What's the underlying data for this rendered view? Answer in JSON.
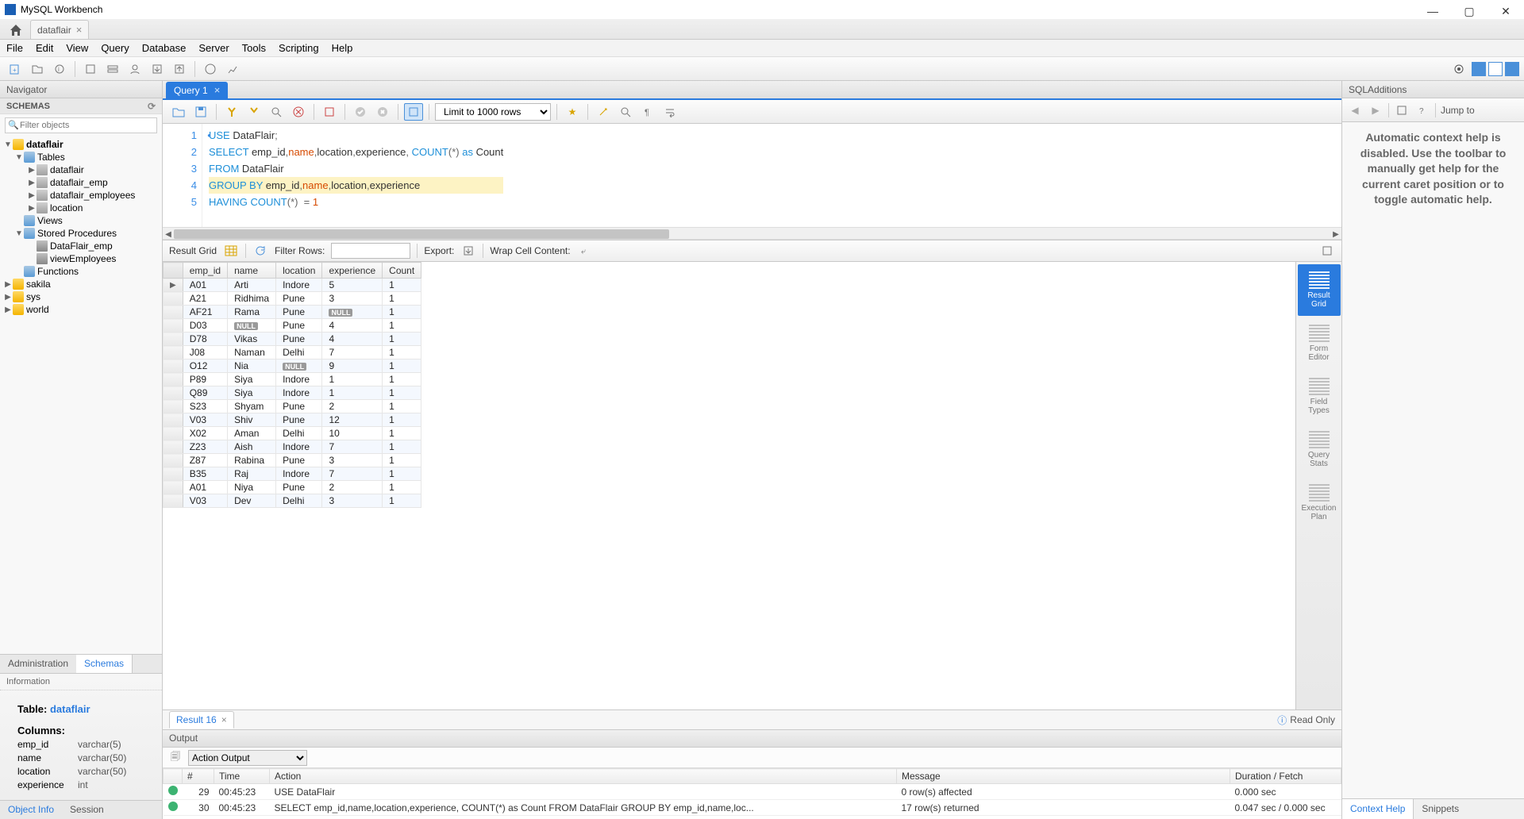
{
  "app_title": "MySQL Workbench",
  "connection_tab": "dataflair",
  "menu": [
    "File",
    "Edit",
    "View",
    "Query",
    "Database",
    "Server",
    "Tools",
    "Scripting",
    "Help"
  ],
  "navigator": {
    "title": "Navigator",
    "schemas_label": "SCHEMAS",
    "filter_placeholder": "Filter objects",
    "tree": {
      "db": "dataflair",
      "tables_label": "Tables",
      "tables": [
        "dataflair",
        "dataflair_emp",
        "dataflair_employees",
        "location"
      ],
      "views_label": "Views",
      "sp_label": "Stored Procedures",
      "sps": [
        "DataFlair_emp",
        "viewEmployees"
      ],
      "functions_label": "Functions",
      "other_dbs": [
        "sakila",
        "sys",
        "world"
      ]
    },
    "bottom_tabs": {
      "admin": "Administration",
      "schemas": "Schemas"
    },
    "info_title": "Information",
    "table_label": "Table:",
    "table_name": "dataflair",
    "columns_label": "Columns:",
    "columns": [
      {
        "name": "emp_id",
        "type": "varchar(5)"
      },
      {
        "name": "name",
        "type": "varchar(50)"
      },
      {
        "name": "location",
        "type": "varchar(50)"
      },
      {
        "name": "experience",
        "type": "int"
      }
    ],
    "foot_tabs": {
      "obj": "Object Info",
      "sess": "Session"
    }
  },
  "query_tab": "Query 1",
  "sql_toolbar": {
    "limit": "Limit to 1000 rows"
  },
  "sql_lines": [
    {
      "n": "1",
      "dot": true,
      "tokens": [
        [
          "kw",
          "USE"
        ],
        [
          "txt",
          " DataFlair"
        ],
        [
          "op",
          ";"
        ]
      ]
    },
    {
      "n": "2",
      "dot": false,
      "tokens": [
        [
          "kw",
          "SELECT"
        ],
        [
          "txt",
          " emp_id"
        ],
        [
          "op",
          ","
        ],
        [
          "ident",
          "name"
        ],
        [
          "op",
          ","
        ],
        [
          "txt",
          "location"
        ],
        [
          "op",
          ","
        ],
        [
          "txt",
          "experience"
        ],
        [
          "op",
          ", "
        ],
        [
          "fn",
          "COUNT"
        ],
        [
          "op",
          "(*) "
        ],
        [
          "kw",
          "as"
        ],
        [
          "txt",
          " Count"
        ]
      ]
    },
    {
      "n": "3",
      "dot": false,
      "tokens": [
        [
          "kw",
          "FROM"
        ],
        [
          "txt",
          " DataFlair"
        ]
      ]
    },
    {
      "n": "4",
      "dot": false,
      "hl": true,
      "tokens": [
        [
          "kw",
          "GROUP BY"
        ],
        [
          "txt",
          " emp_id"
        ],
        [
          "op",
          ","
        ],
        [
          "ident",
          "name"
        ],
        [
          "op",
          ","
        ],
        [
          "txt",
          "location"
        ],
        [
          "op",
          ","
        ],
        [
          "txt",
          "experience"
        ]
      ]
    },
    {
      "n": "5",
      "dot": false,
      "tokens": [
        [
          "kw",
          "HAVING"
        ],
        [
          "txt",
          " "
        ],
        [
          "fn",
          "COUNT"
        ],
        [
          "op",
          "(*)  = "
        ],
        [
          "num",
          "1"
        ]
      ]
    }
  ],
  "result_bar": {
    "label": "Result Grid",
    "filter_label": "Filter Rows:",
    "export_label": "Export:",
    "wrap_label": "Wrap Cell Content:"
  },
  "grid": {
    "headers": [
      "emp_id",
      "name",
      "location",
      "experience",
      "Count"
    ],
    "rows": [
      [
        "A01",
        "Arti",
        "Indore",
        "5",
        "1"
      ],
      [
        "A21",
        "Ridhima",
        "Pune",
        "3",
        "1"
      ],
      [
        "AF21",
        "Rama",
        "Pune",
        "__NULL__",
        "1"
      ],
      [
        "D03",
        "__NULL__",
        "Pune",
        "4",
        "1"
      ],
      [
        "D78",
        "Vikas",
        "Pune",
        "4",
        "1"
      ],
      [
        "J08",
        "Naman",
        "Delhi",
        "7",
        "1"
      ],
      [
        "O12",
        "Nia",
        "__NULL__",
        "9",
        "1"
      ],
      [
        "P89",
        "Siya",
        "Indore",
        "1",
        "1"
      ],
      [
        "Q89",
        "Siya",
        "Indore",
        "1",
        "1"
      ],
      [
        "S23",
        "Shyam",
        "Pune",
        "2",
        "1"
      ],
      [
        "V03",
        "Shiv",
        "Pune",
        "12",
        "1"
      ],
      [
        "X02",
        "Aman",
        "Delhi",
        "10",
        "1"
      ],
      [
        "Z23",
        "Aish",
        "Indore",
        "7",
        "1"
      ],
      [
        "Z87",
        "Rabina",
        "Pune",
        "3",
        "1"
      ],
      [
        "B35",
        "Raj",
        "Indore",
        "7",
        "1"
      ],
      [
        "A01",
        "Niya",
        "Pune",
        "2",
        "1"
      ],
      [
        "V03",
        "Dev",
        "Delhi",
        "3",
        "1"
      ]
    ]
  },
  "rail": [
    "Result Grid",
    "Form Editor",
    "Field Types",
    "Query Stats",
    "Execution Plan"
  ],
  "result_tab": "Result 16",
  "readonly_label": "Read Only",
  "output": {
    "title": "Output",
    "dropdown": "Action Output",
    "headers": [
      "",
      "#",
      "Time",
      "Action",
      "Message",
      "Duration / Fetch"
    ],
    "rows": [
      {
        "status": "ok",
        "n": "29",
        "time": "00:45:23",
        "action": "USE DataFlair",
        "msg": "0 row(s) affected",
        "dur": "0.000 sec"
      },
      {
        "status": "ok",
        "n": "30",
        "time": "00:45:23",
        "action": "SELECT emp_id,name,location,experience, COUNT(*) as Count FROM DataFlair GROUP BY emp_id,name,loc...",
        "msg": "17 row(s) returned",
        "dur": "0.047 sec / 0.000 sec"
      }
    ]
  },
  "sql_additions": {
    "title": "SQLAdditions",
    "jump": "Jump to",
    "body": "Automatic context help is disabled. Use the toolbar to manually get help for the current caret position or to toggle automatic help.",
    "tabs": {
      "ctx": "Context Help",
      "snip": "Snippets"
    }
  }
}
